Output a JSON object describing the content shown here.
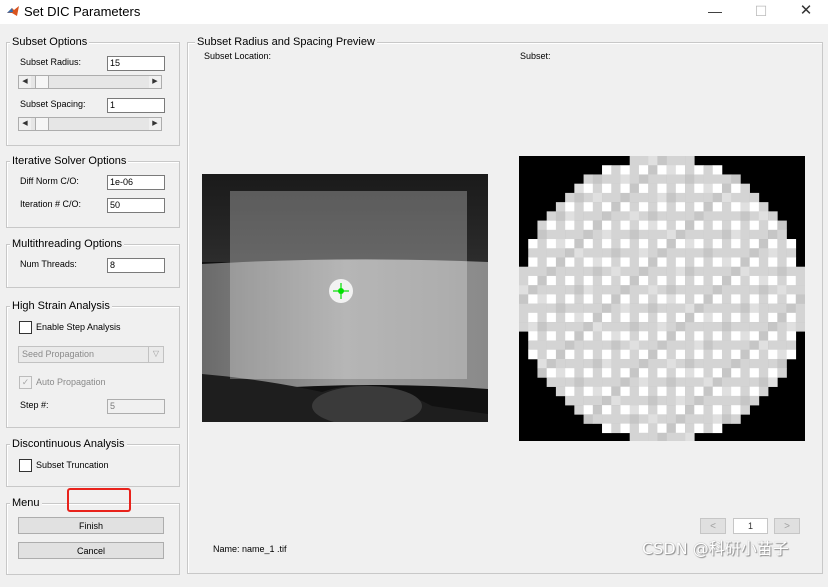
{
  "window": {
    "title": "Set DIC Parameters",
    "icon": "matlab-icon",
    "minimize": "—",
    "maximize": "☐",
    "close": "✕"
  },
  "subset_options": {
    "title": "Subset Options",
    "radius_label": "Subset Radius:",
    "radius_value": "15",
    "spacing_label": "Subset Spacing:",
    "spacing_value": "1"
  },
  "iterative_solver": {
    "title": "Iterative Solver Options",
    "diff_norm_label": "Diff Norm C/O:",
    "diff_norm_value": "1e-06",
    "iteration_label": "Iteration # C/O:",
    "iteration_value": "50"
  },
  "multithreading": {
    "title": "Multithreading Options",
    "num_threads_label": "Num Threads:",
    "num_threads_value": "8"
  },
  "high_strain": {
    "title": "High Strain Analysis",
    "enable_step_label": "Enable Step Analysis",
    "seed_propagation": "Seed Propagation",
    "auto_propagation_label": "Auto Propagation",
    "step_label": "Step #:",
    "step_value": "5"
  },
  "discontinuous": {
    "title": "Discontinuous Analysis",
    "subset_truncation_label": "Subset Truncation"
  },
  "menu": {
    "title": "Menu",
    "finish_label": "Finish",
    "cancel_label": "Cancel"
  },
  "preview": {
    "title": "Subset Radius and Spacing Preview",
    "location_label": "Subset Location:",
    "subset_label": "Subset:",
    "name_text": "Name: name_1 .tif",
    "prev": "<",
    "next": ">",
    "page": "1"
  },
  "watermark": "CSDN @科研小苗子",
  "colors": {
    "highlight": "#e8221b",
    "marker": "#00e000"
  }
}
